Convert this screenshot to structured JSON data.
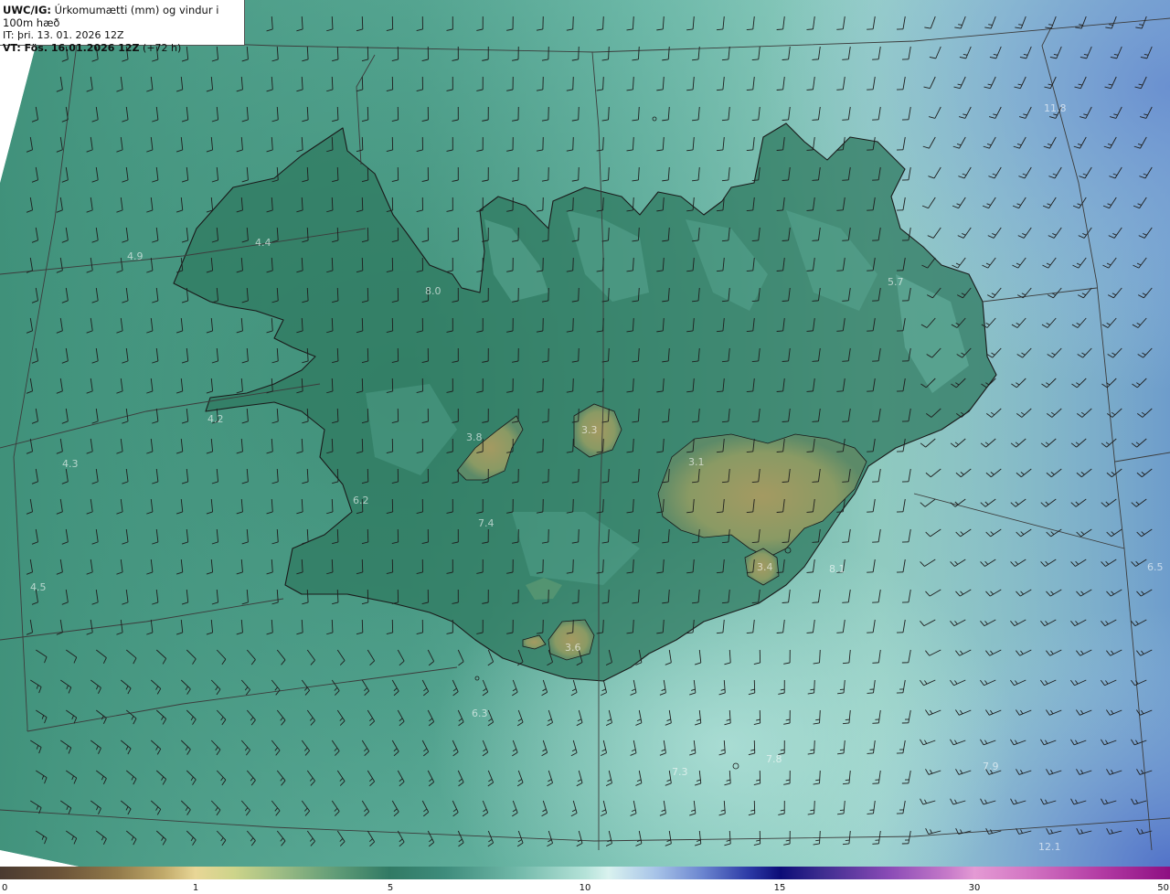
{
  "header": {
    "model": "UWC/IG:",
    "title": "Úrkomumætti (mm) og vindur i 100m hæð",
    "init_time": "IT: þri. 13. 01. 2026 12Z",
    "valid_prefix": "VT: Fös. 16.01.2026 12Z",
    "valid_suffix": "(+72 h)"
  },
  "colorbar": {
    "ticks": [
      "0",
      "1",
      "5",
      "10",
      "15",
      "30",
      "50"
    ]
  },
  "point_values": [
    "11.8",
    "4.4",
    "4.9",
    "5.7",
    "8.0",
    "4.2",
    "3.8",
    "3.3",
    "3.1",
    "4.3",
    "6.2",
    "7.4",
    "4.5",
    "3.4",
    "8.1",
    "6.5",
    "3.6",
    "6.3",
    "7.3",
    "7.8",
    "7.9",
    "12.1"
  ],
  "icons": {
    "wind_barbs": "wind-barb-icon",
    "coastline": "coastline-icon"
  },
  "colors": {
    "coastline": "#1a1a1a",
    "grid_lines": "#3c3c3c",
    "barb": "#1e1e1e",
    "land_low": "#2e7d62",
    "land_high": "#8c9a60",
    "sea": "#7fcfbe"
  }
}
